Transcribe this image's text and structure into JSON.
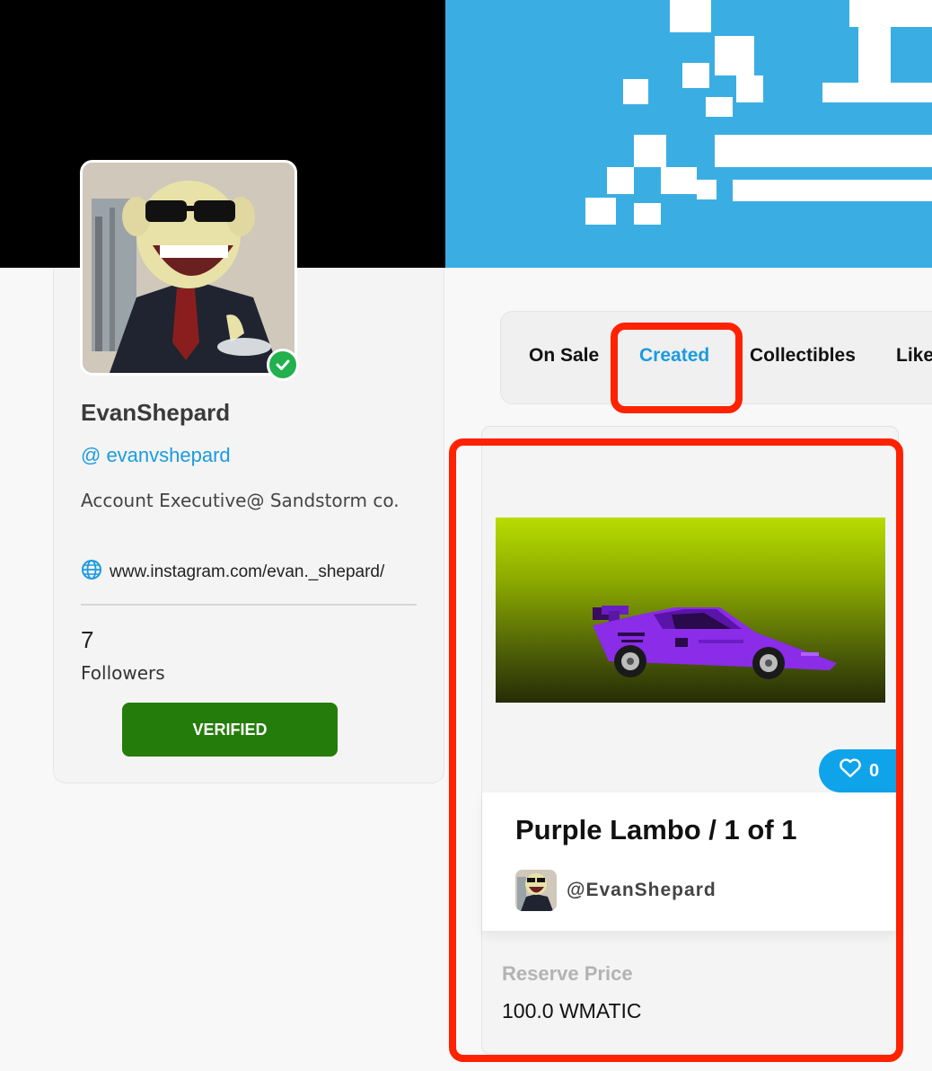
{
  "profile": {
    "name": "EvanShepard",
    "handle": "@ evanvshepard",
    "bio": "Account Executive@ Sandstorm co.",
    "website": "www.instagram.com/evan._shepard/",
    "followers_count": "7",
    "followers_label": "Followers",
    "verified_label": "VERIFIED"
  },
  "tabs": [
    {
      "label": "On Sale",
      "active": false
    },
    {
      "label": "Created",
      "active": true
    },
    {
      "label": "Collectibles",
      "active": false
    },
    {
      "label": "Like",
      "active": false
    }
  ],
  "nft": {
    "title": "Purple Lambo / 1 of 1",
    "creator": "@EvanShepard",
    "likes": "0",
    "reserve_label": "Reserve Price",
    "reserve_value": "100.0 WMATIC"
  },
  "colors": {
    "accent": "#1b9be0",
    "verified_green": "#247c0a",
    "highlight_red": "#ff2200",
    "like_blue": "#0fa3ea"
  }
}
